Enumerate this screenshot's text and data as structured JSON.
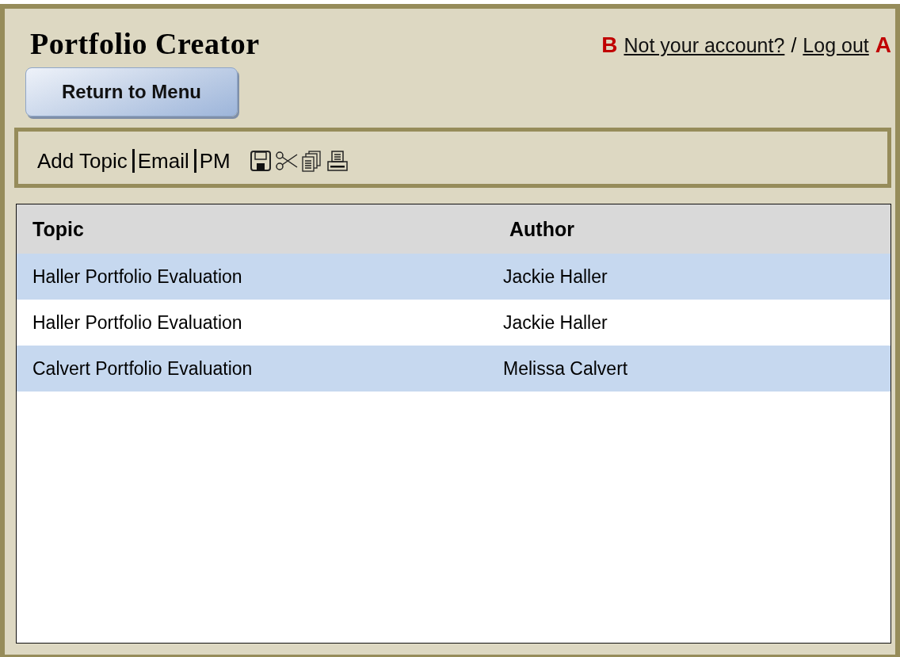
{
  "header": {
    "title": "Portfolio Creator",
    "marker_left": "B",
    "marker_right": "A",
    "links": [
      "Not your account?",
      "Log out"
    ],
    "separator": "/"
  },
  "return_button": "Return to Menu",
  "toolbar": {
    "items": [
      "Add Topic",
      "Email",
      "PM"
    ]
  },
  "table": {
    "columns": [
      "Topic",
      "Author"
    ],
    "rows": [
      {
        "topic": "Haller Portfolio Evaluation",
        "author": "Jackie Haller",
        "highlighted": true
      },
      {
        "topic": "Haller Portfolio Evaluation",
        "author": "Jackie Haller",
        "highlighted": false
      },
      {
        "topic": "Calvert Portfolio Evaluation",
        "author": "Melissa Calvert",
        "highlighted": true
      }
    ]
  }
}
